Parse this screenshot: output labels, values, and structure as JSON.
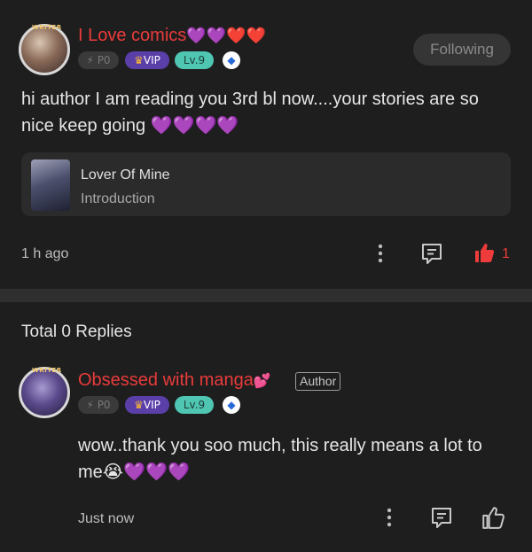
{
  "comment": {
    "writer_tag": "WRITER",
    "username": "I Love comics",
    "username_emoji": "💜💜❤️❤️",
    "badges": {
      "po": "P0",
      "vip": "VIP",
      "level": "Lv.9",
      "eth": "◆"
    },
    "follow_label": "Following",
    "text_line1": "hi author I am reading you 3rd bl now....your stories are so",
    "text_line2": "nice keep going 💜💜💜💜",
    "book": {
      "title": "Lover Of Mine",
      "subtitle": "Introduction"
    },
    "time": "1 h ago",
    "like_count": "1"
  },
  "replies": {
    "header": "Total 0 Replies"
  },
  "reply": {
    "writer_tag": "WRITER",
    "username": "Obsessed with manga",
    "username_emoji": "💕",
    "author_label": "Author",
    "badges": {
      "po": "P0",
      "vip": "VIP",
      "level": "Lv.9",
      "eth": "◆"
    },
    "text_line1": "wow..thank you soo much, this really means a lot to",
    "text_line2": "me😭💜💜💜",
    "time": "Just now"
  },
  "colors": {
    "username": "#ea3b3b",
    "like_active": "#ee3b3b",
    "vip": "#5b3fa9",
    "level": "#4fc6b2"
  }
}
